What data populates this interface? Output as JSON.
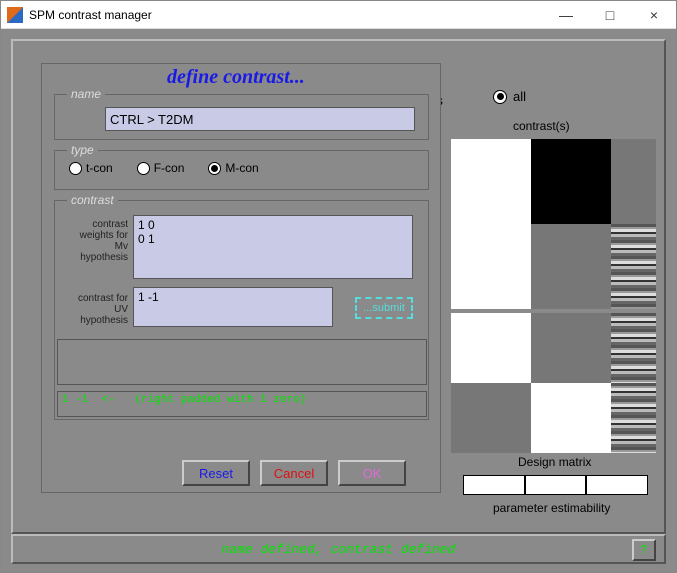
{
  "window": {
    "title": "SPM contrast manager",
    "minimize": "—",
    "maximize": "□",
    "close": "×"
  },
  "define": {
    "heading": "define contrast...",
    "name_legend": "name",
    "name_value": "CTRL > T2DM",
    "type_legend": "type",
    "types": {
      "t": "t-con",
      "f": "F-con",
      "m": "M-con"
    },
    "selected_type": "M-con",
    "contrast_legend": "contrast",
    "mv_label": "contrast\nweights\nfor Mv\nhypothesis",
    "mv_value": "1 0\n0 1",
    "uv_label": "contrast for\nUV hypothesis",
    "uv_value": "1 -1",
    "submit": "...submit",
    "msg1": "",
    "msg2": "1 -1  <-   (right padded with 1 zero)",
    "reset": "Reset",
    "cancel": "Cancel",
    "ok": "OK"
  },
  "right": {
    "asts": "asts",
    "all": "all",
    "contrasts": "contrast(s)",
    "design_matrix": "Design matrix",
    "param_estim": "parameter estimability"
  },
  "status": {
    "text": "name defined, contrast defined",
    "help": "?"
  }
}
